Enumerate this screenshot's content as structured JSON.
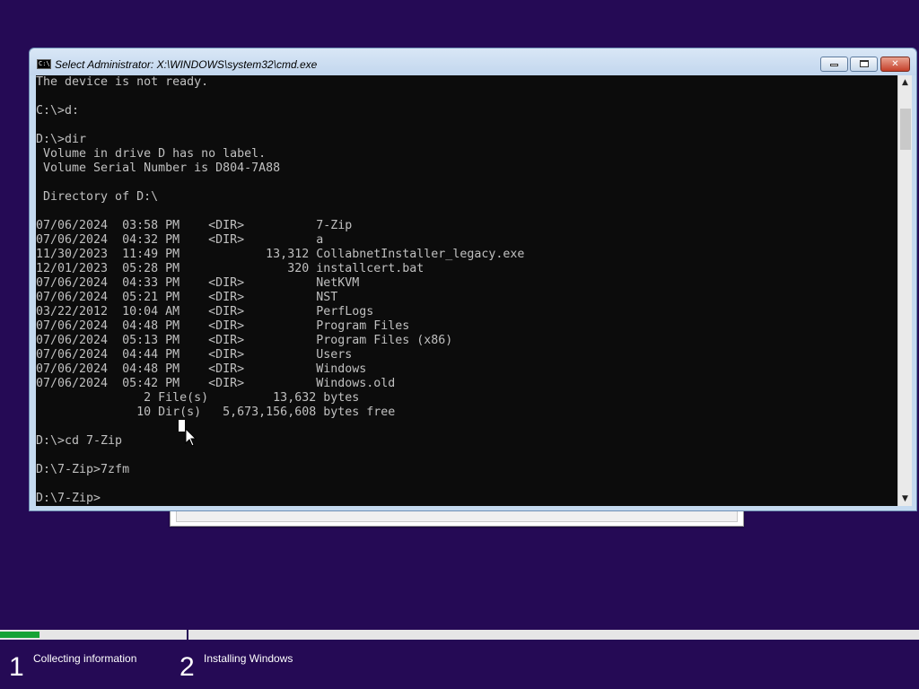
{
  "window": {
    "title": "Select Administrator: X:\\WINDOWS\\system32\\cmd.exe",
    "icon": "cmd-console-icon",
    "icon_text": "C:\\",
    "min_glyph": "minimize",
    "max_glyph": "maximize",
    "close_glyph": "✕"
  },
  "console": {
    "lines": [
      "The device is not ready.",
      "",
      "C:\\>d:",
      "",
      "D:\\>dir",
      " Volume in drive D has no label.",
      " Volume Serial Number is D804-7A88",
      "",
      " Directory of D:\\",
      "",
      "07/06/2024  03:58 PM    <DIR>          7-Zip",
      "07/06/2024  04:32 PM    <DIR>          a",
      "11/30/2023  11:49 PM            13,312 CollabnetInstaller_legacy.exe",
      "12/01/2023  05:28 PM               320 installcert.bat",
      "07/06/2024  04:33 PM    <DIR>          NetKVM",
      "07/06/2024  05:21 PM    <DIR>          NST",
      "03/22/2012  10:04 AM    <DIR>          PerfLogs",
      "07/06/2024  04:48 PM    <DIR>          Program Files",
      "07/06/2024  05:13 PM    <DIR>          Program Files (x86)",
      "07/06/2024  04:44 PM    <DIR>          Users",
      "07/06/2024  04:48 PM    <DIR>          Windows",
      "07/06/2024  05:42 PM    <DIR>          Windows.old",
      "               2 File(s)         13,632 bytes",
      "              10 Dir(s)   5,673,156,608 bytes free",
      "",
      "D:\\>cd 7-Zip",
      "",
      "D:\\7-Zip>7zfm",
      "",
      "D:\\7-Zip>"
    ],
    "background": "#0c0c0c",
    "foreground": "#c0c0c0"
  },
  "scrollbar": {
    "up_arrow": "▲",
    "down_arrow": "▼"
  },
  "setup": {
    "progress_fraction": 0.043,
    "progress_color": "#16a336",
    "steps": [
      {
        "number": "1",
        "label": "Collecting information"
      },
      {
        "number": "2",
        "label": "Installing Windows"
      }
    ]
  },
  "colors": {
    "desktop": "#250a55",
    "titlebar": "#c5daf0",
    "close_button": "#c5402a"
  }
}
